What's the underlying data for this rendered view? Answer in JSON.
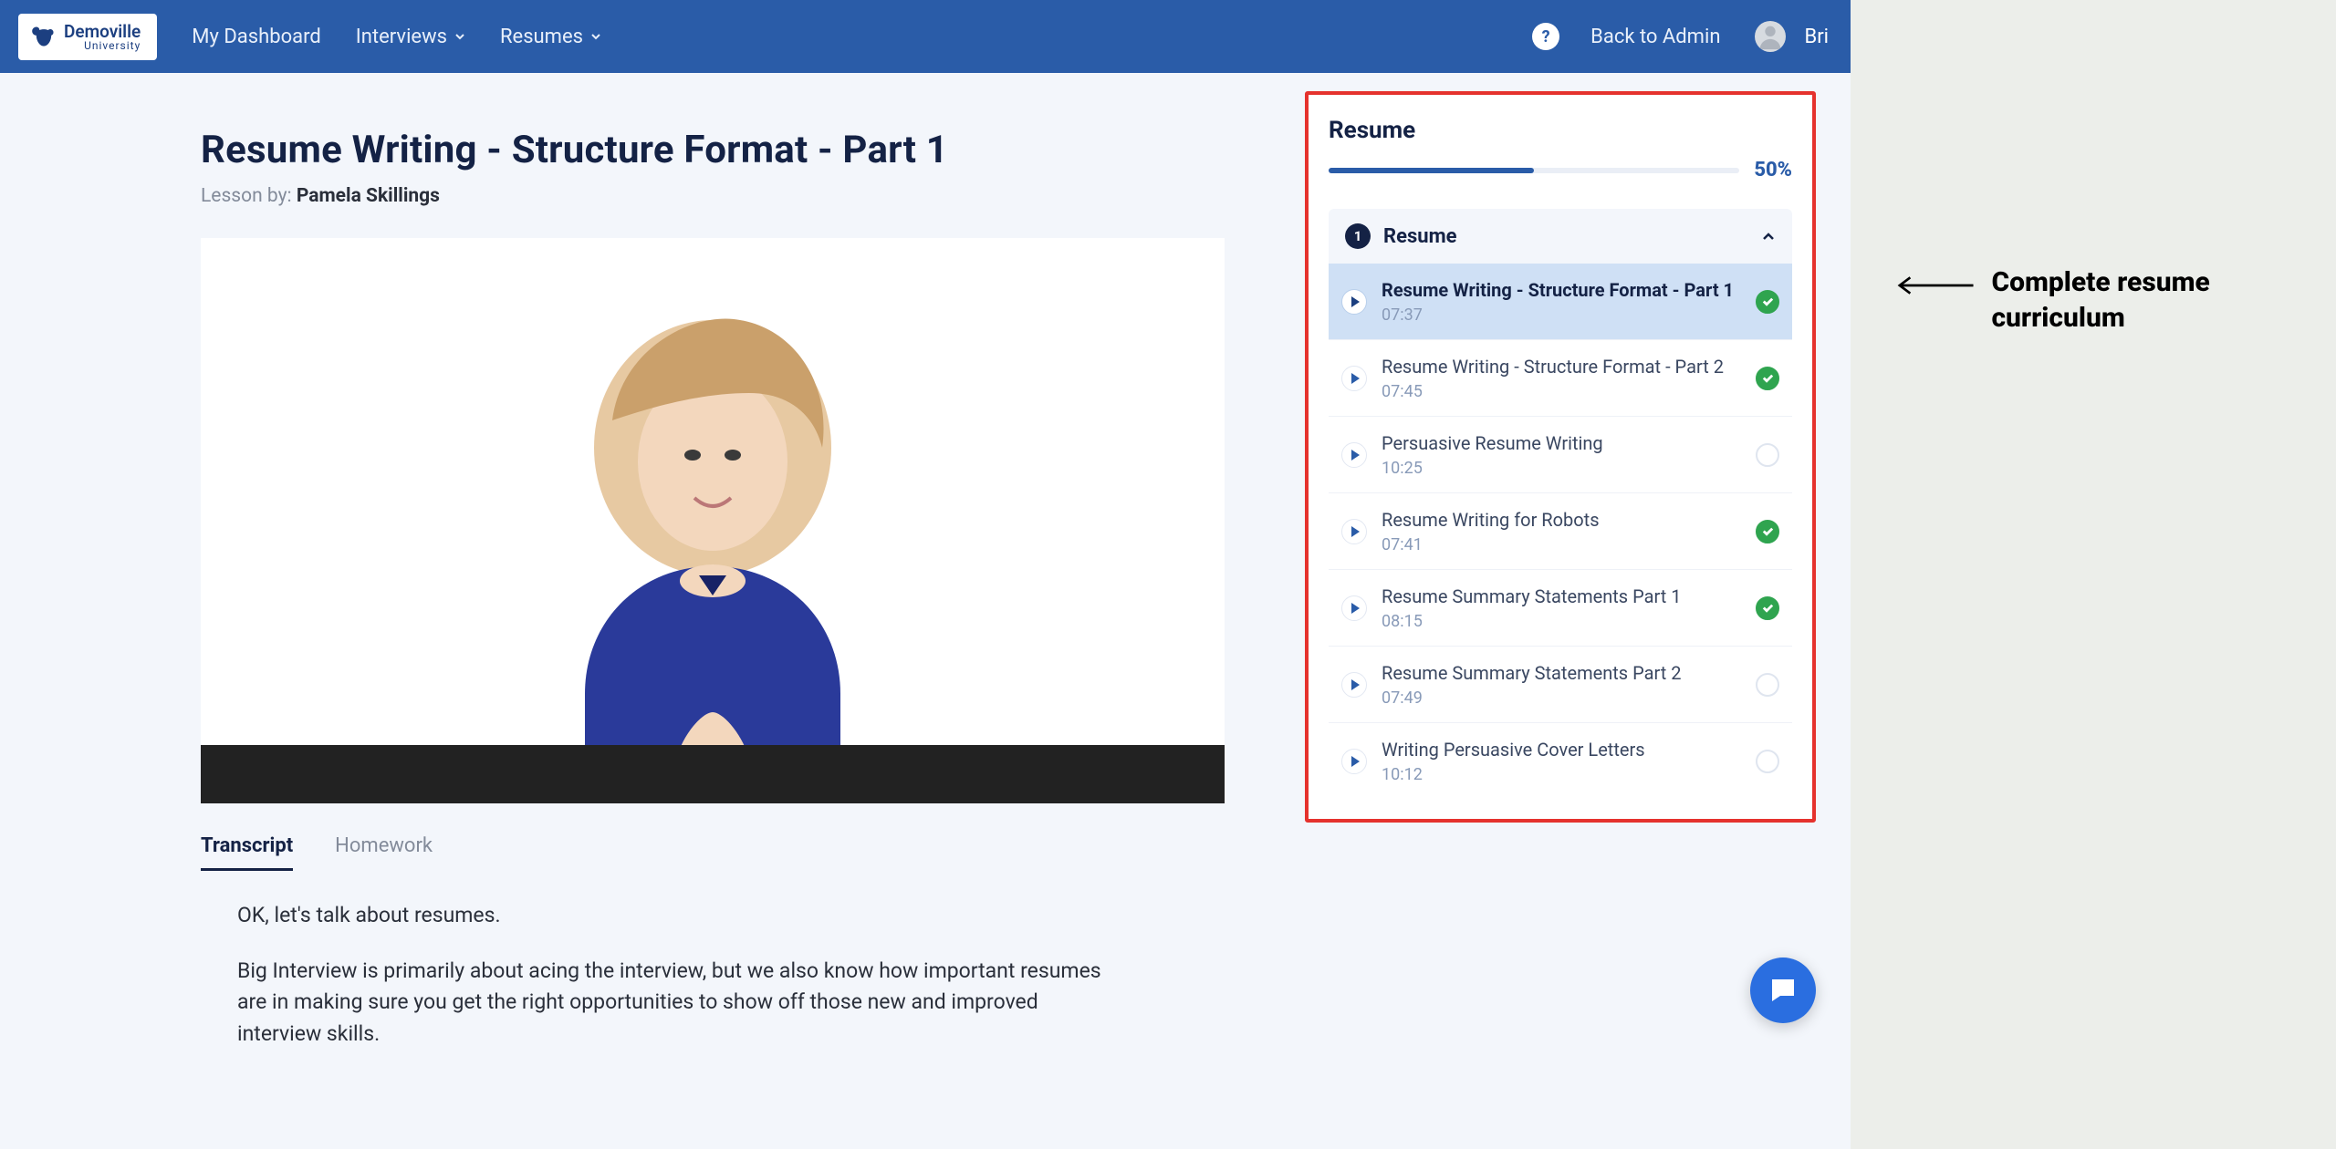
{
  "brand": {
    "top": "Demoville",
    "bottom": "University"
  },
  "nav": {
    "dashboard": "My Dashboard",
    "interviews": "Interviews",
    "resumes": "Resumes",
    "back_admin": "Back to Admin",
    "username": "Bri"
  },
  "page": {
    "title": "Resume Writing - Structure Format - Part 1",
    "lesson_by_prefix": "Lesson by: ",
    "lesson_by_name": "Pamela Skillings"
  },
  "tabs": {
    "transcript": "Transcript",
    "homework": "Homework"
  },
  "transcript": {
    "p1": "OK, let's talk about resumes.",
    "p2": "Big Interview is primarily about acing the interview, but we also know how important resumes are in making sure you get the right opportunities to show off those new and improved interview skills."
  },
  "sidebar": {
    "title": "Resume",
    "progress_pct": "50%",
    "progress_fill_pct": "50%",
    "module": {
      "number": "1",
      "title": "Resume"
    },
    "lessons": [
      {
        "title": "Resume Writing - Structure Format - Part 1",
        "duration": "07:37",
        "done": true,
        "current": true
      },
      {
        "title": "Resume Writing - Structure Format - Part 2",
        "duration": "07:45",
        "done": true,
        "current": false
      },
      {
        "title": "Persuasive Resume Writing",
        "duration": "10:25",
        "done": false,
        "current": false
      },
      {
        "title": "Resume Writing for Robots",
        "duration": "07:41",
        "done": true,
        "current": false
      },
      {
        "title": "Resume Summary Statements Part 1",
        "duration": "08:15",
        "done": true,
        "current": false
      },
      {
        "title": "Resume Summary Statements Part 2",
        "duration": "07:49",
        "done": false,
        "current": false
      },
      {
        "title": "Writing Persuasive Cover Letters",
        "duration": "10:12",
        "done": false,
        "current": false
      }
    ]
  },
  "annotation": {
    "label": "Complete resume curriculum"
  }
}
